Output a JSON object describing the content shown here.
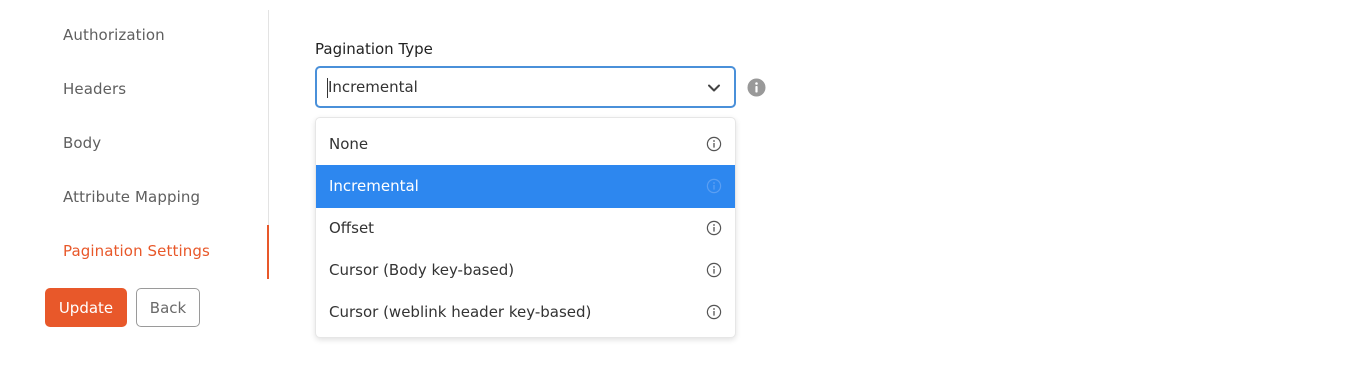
{
  "sidebar": {
    "items": [
      {
        "label": "Authorization"
      },
      {
        "label": "Headers"
      },
      {
        "label": "Body"
      },
      {
        "label": "Attribute Mapping"
      },
      {
        "label": "Pagination Settings"
      }
    ],
    "active_index": 4
  },
  "actions": {
    "update_label": "Update",
    "back_label": "Back"
  },
  "pagination": {
    "label": "Pagination Type",
    "selected_value": "Incremental",
    "options": [
      {
        "label": "None"
      },
      {
        "label": "Incremental"
      },
      {
        "label": "Offset"
      },
      {
        "label": "Cursor (Body key-based)"
      },
      {
        "label": "Cursor (weblink header key-based)"
      }
    ],
    "highlighted_index": 1
  },
  "colors": {
    "accent": "#e8582a",
    "selection": "#2d87ef",
    "focus_border": "#4a90d9"
  },
  "icons": {
    "chevron": "chevron-down-icon",
    "info": "info-icon"
  }
}
